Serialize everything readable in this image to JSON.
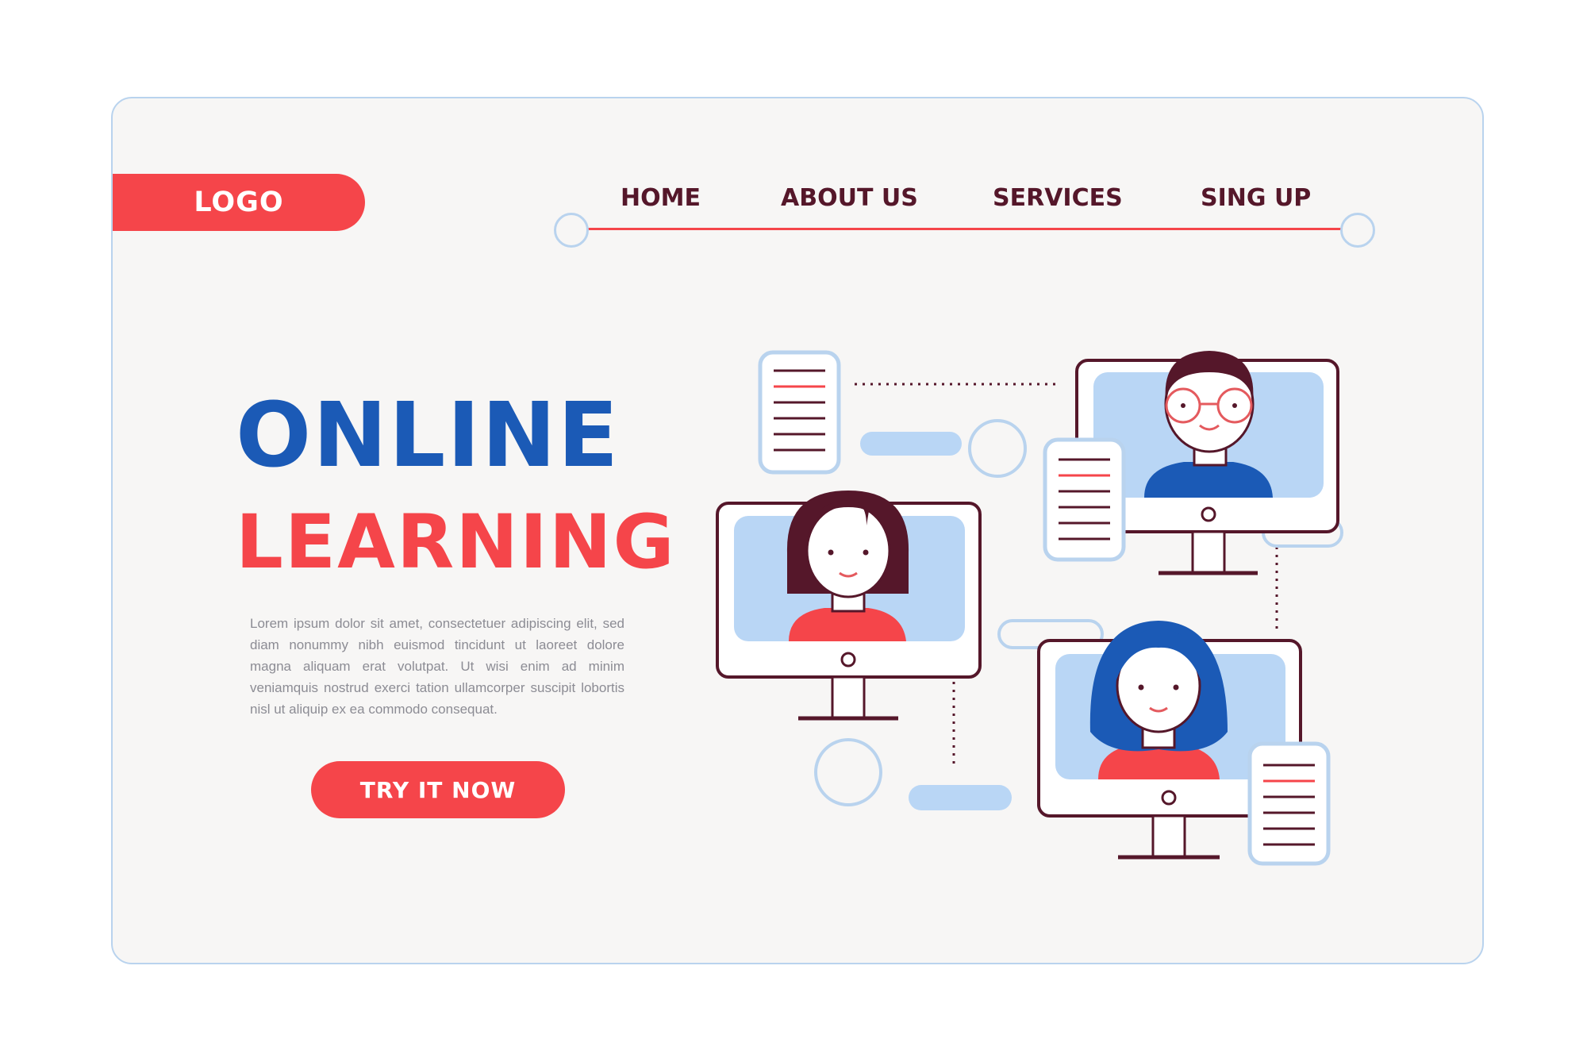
{
  "logo": {
    "label": "LOGO"
  },
  "nav": {
    "items": [
      "HOME",
      "ABOUT US",
      "SERVICES",
      "SING UP"
    ]
  },
  "hero": {
    "title_line1": "ONLINE",
    "title_line2": "LEARNING",
    "body": "Lorem ipsum dolor sit amet, consectetuer adipiscing elit, sed diam nonummy nibh euismod tincidunt ut laoreet dolore magna aliquam erat volutpat. Ut wisi enim ad minim veniamquis nostrud exerci tation ullamcorper suscipit lobortis nisl ut aliquip ex ea commodo consequat.",
    "cta_label": "TRY IT NOW"
  },
  "colors": {
    "accent_red": "#f5454a",
    "brand_blue": "#1b5ab6",
    "dark_maroon": "#55172a",
    "light_blue": "#b9d3ee"
  }
}
